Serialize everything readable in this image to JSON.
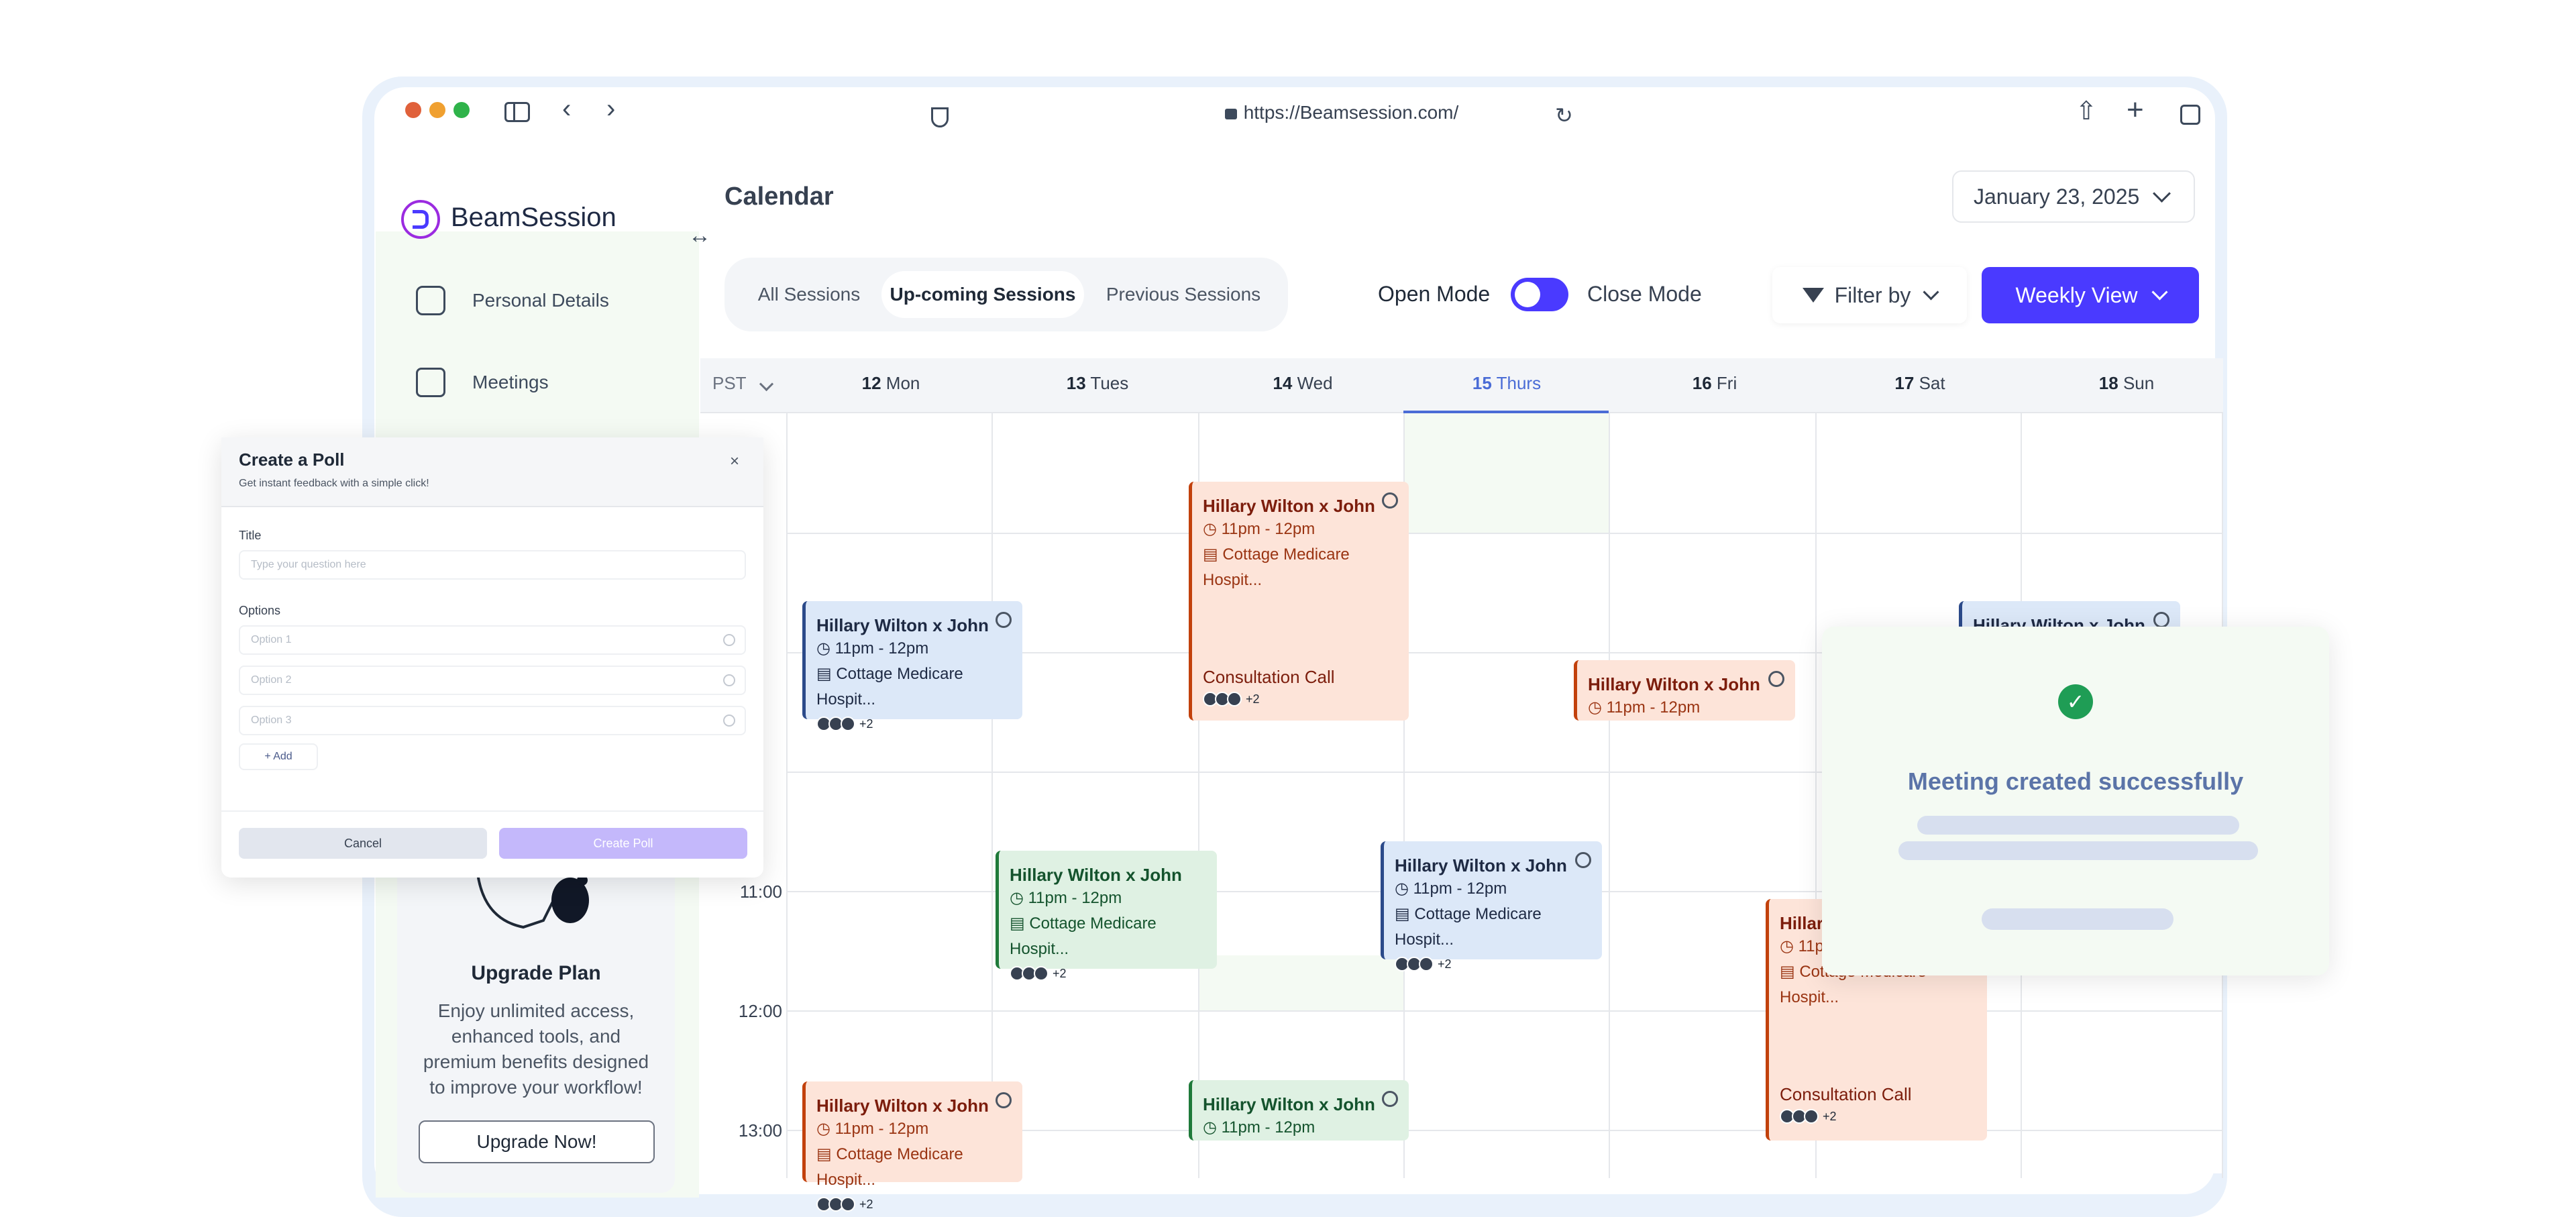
{
  "browser": {
    "url": "https://Beamsession.com/",
    "traffic_lights": [
      "#e0613b",
      "#f0a030",
      "#2fb34a"
    ]
  },
  "sidebar": {
    "brand": "BeamSession",
    "items": [
      {
        "label": "Personal Details",
        "icon": "profile-card-icon"
      },
      {
        "label": "Meetings",
        "icon": "presentation-icon"
      }
    ],
    "upgrade": {
      "title": "Upgrade Plan",
      "description": "Enjoy unlimited access, enhanced tools, and premium benefits designed to improve your workflow!",
      "button": "Upgrade Now!"
    }
  },
  "header": {
    "title": "Calendar",
    "date": "January 23, 2025"
  },
  "toolbar": {
    "tabs": [
      "All Sessions",
      "Up-coming Sessions",
      "Previous Sessions"
    ],
    "active_tab": 1,
    "open_mode": "Open Mode",
    "close_mode": "Close Mode",
    "filter_label": "Filter by",
    "view_label": "Weekly View",
    "accent": "#4a3aff"
  },
  "calendar": {
    "timezone": "PST",
    "days": [
      {
        "num": "12",
        "name": "Mon"
      },
      {
        "num": "13",
        "name": "Tues"
      },
      {
        "num": "14",
        "name": "Wed"
      },
      {
        "num": "15",
        "name": "Thurs"
      },
      {
        "num": "16",
        "name": "Fri"
      },
      {
        "num": "17",
        "name": "Sat"
      },
      {
        "num": "18",
        "name": "Sun"
      }
    ],
    "today_index": 3,
    "times": [
      "11:00",
      "12:00",
      "13:00"
    ],
    "event_title": "Hillary Wilton x John",
    "event_time": "11pm - 12pm",
    "event_location": "Cottage Medicare Hospit...",
    "event_call": "Consultation Call",
    "event_more": "+2"
  },
  "poll": {
    "title": "Create a Poll",
    "subtitle": "Get instant feedback with a simple click!",
    "title_label": "Title",
    "title_placeholder": "Type your question here",
    "options_label": "Options",
    "options": [
      "Option 1",
      "Option 2",
      "Option 3"
    ],
    "add_label": "+ Add",
    "cancel_label": "Cancel",
    "create_label": "Create Poll"
  },
  "toast": {
    "message": "Meeting created successfully"
  }
}
